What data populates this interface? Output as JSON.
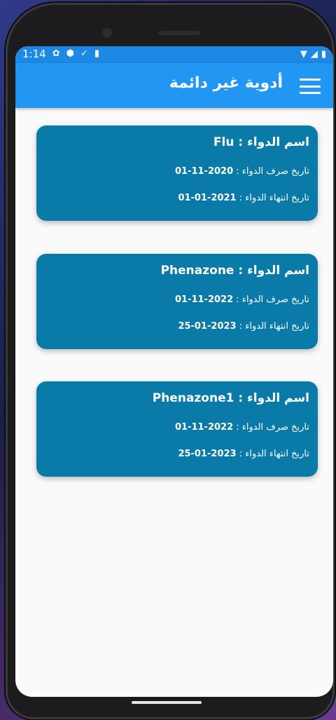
{
  "status": {
    "time": "1:14",
    "icons_left": [
      "gear-icon",
      "shield-icon",
      "download-check-icon",
      "sd-card-icon"
    ],
    "icons_right": [
      "wifi-icon",
      "signal-icon",
      "battery-icon"
    ]
  },
  "appbar": {
    "title": "أدوية غير دائمة",
    "menu_icon": "hamburger-icon"
  },
  "colors": {
    "statusbar": "#1e88e5",
    "appbar": "#2196f3",
    "card": "#0a7aa8"
  },
  "medicines": [
    {
      "name_label": "اسم الدواء : ",
      "name": "Flu",
      "issue_label": "تاريخ صرف الدواء  :  ",
      "issue_date": "01-11-2020",
      "expiry_label": "تاريخ انتهاء  الدواء :  ",
      "expiry_date": "01-01-2021"
    },
    {
      "name_label": "اسم الدواء : ",
      "name": "Phenazone",
      "issue_label": "تاريخ صرف الدواء  :  ",
      "issue_date": "01-11-2022",
      "expiry_label": "تاريخ انتهاء  الدواء :  ",
      "expiry_date": "25-01-2023"
    },
    {
      "name_label": "اسم الدواء : ",
      "name": "Phenazone1",
      "issue_label": "تاريخ صرف الدواء  :  ",
      "issue_date": "01-11-2022",
      "expiry_label": "تاريخ انتهاء  الدواء :  ",
      "expiry_date": "25-01-2023"
    }
  ]
}
